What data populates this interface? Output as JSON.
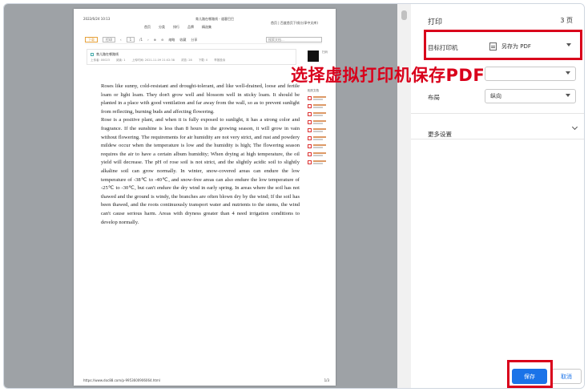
{
  "doc": {
    "date": "2022/6/24 10:13",
    "title": "育儿路在哪路线 - 道客巴巴",
    "header_right": "首页 | 百度首页下线(分享中文库)",
    "nav": [
      "首页",
      "分类",
      "排行",
      "品牌",
      "精选集"
    ],
    "toolbar": {
      "download": "下载",
      "print": "打印",
      "page_current": "1",
      "page_total": "/1",
      "zoom": "缩略",
      "collect": "收藏",
      "share": "分享",
      "search_placeholder": "搜索文档..."
    },
    "info": {
      "title": "育儿路在哪路线",
      "meta": [
        "上传者: 00023",
        "阅读: 1",
        "上传时间: 2021-11-09 21:02:38",
        "浏览: 28",
        "下载: 0",
        "举报投诉"
      ]
    },
    "qr_side": "扫码",
    "side_title": "相关文档",
    "paragraphs": [
      "Roses like sunny, cold-resistant and drought-tolerant, and like well-drained, loose and fertile loam or light loam. They don't grow well and blossom well in sticky loam. It should be planted in a place with good ventilation and far away from the wall, so as to prevent sunlight from reflecting, burning buds and affecting flowering.",
      "Rose is a positive plant, and when it is fully exposed to sunlight, it has a strong color and fragrance. If the sunshine is less than 8 hours in the growing season, it will grow in vain without flowering. The requirements for air humidity are not very strict, and rust and powdery mildew occur when the temperature is low and the humidity is high; The flowering season requires the air to have a certain album humidity; When drying at high temperature, the oil yield will decrease. The pH of rose soil is not strict, and the slightly acidic soil to slightly alkaline soil can grow normally. In winter, snow-covered areas can endure the low temperature of -38℃ to -40℃, and snow-free areas can also endure the low temperature of -25℃ to -30℃, but can't endure the dry wind in early spring. In areas where the soil has not thawed and the ground is windy, the branches are often blown dry by the wind; If the soil has been thawed, and the roots continuously transport water and nutrients to the stems, the wind can't cause serious harm. Areas with dryness greater than 4 need irrigation conditions to develop normally."
    ],
    "footer_url": "https://www.doc88.com/p-9953600906064.html",
    "footer_page": "1/3"
  },
  "annotation": "选择虚拟打印机保存PDF",
  "dialog": {
    "title": "打印",
    "pages": "3 页",
    "destination_label": "目标打印机",
    "destination_value": "另存为 PDF",
    "layout_label": "布局",
    "layout_value": "纵向",
    "more_settings": "更多设置",
    "save_label": "保存",
    "cancel_label": "取消"
  },
  "colors": {
    "accent": "#1a73e8",
    "annotation": "#d9001b",
    "preview_bg": "#9ea2a6"
  }
}
